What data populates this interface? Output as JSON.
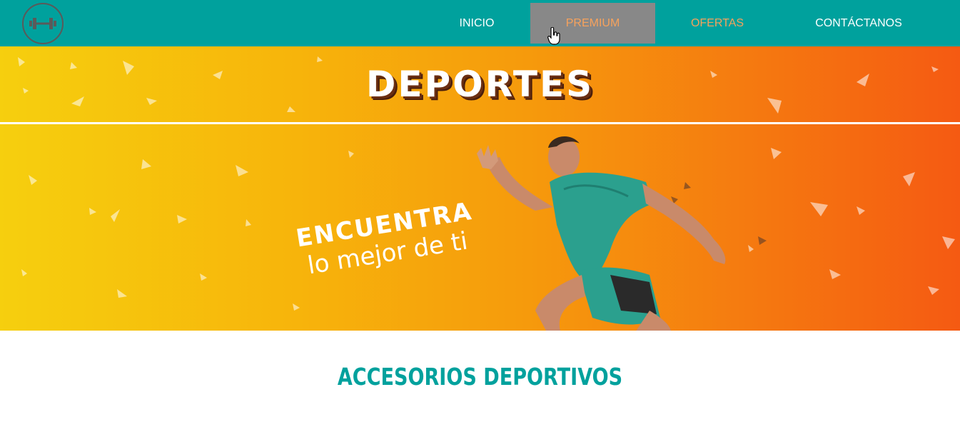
{
  "nav": {
    "items": [
      {
        "label": "INICIO"
      },
      {
        "label": "PREMIUM"
      },
      {
        "label": "OFERTAS"
      },
      {
        "label": "CONTÁCTANOS"
      }
    ]
  },
  "icons": {
    "logo": "dumbbell-icon",
    "cursor": "hand-pointer-icon"
  },
  "hero": {
    "title": "DEPORTES",
    "tagline_line1": "ENCUENTRA",
    "tagline_line2": "lo mejor de ti"
  },
  "section": {
    "title": "ACCESORIOS DEPORTIVOS"
  },
  "colors": {
    "topbar": "#00a19d",
    "accent_text": "#f7a25c",
    "hover_bg": "#888888",
    "gradient_start": "#f6cf0e",
    "gradient_end": "#f55a12",
    "section_title": "#00a19d"
  }
}
